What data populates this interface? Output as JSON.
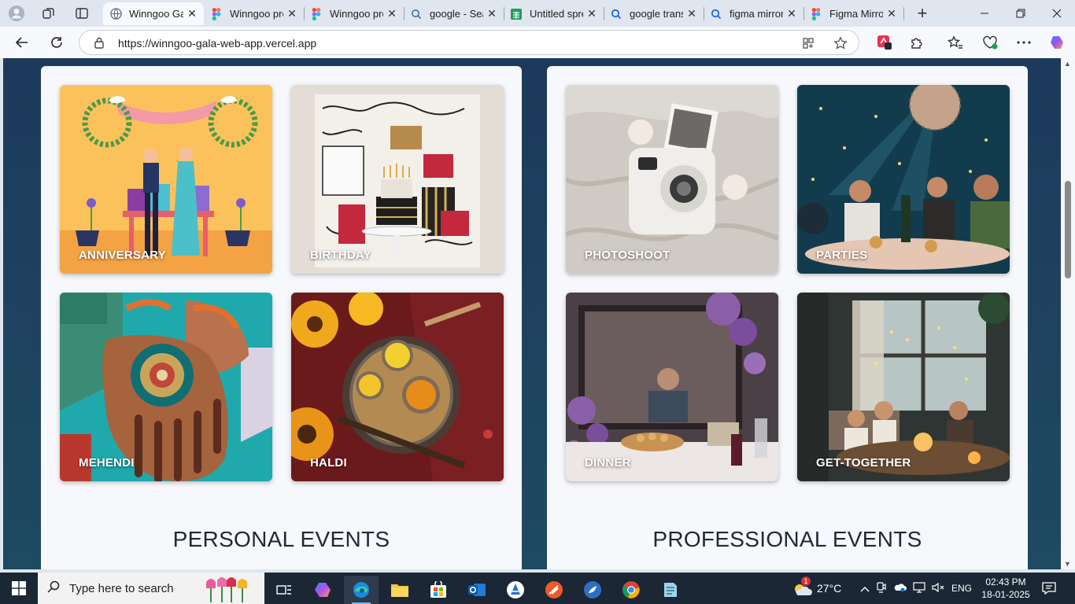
{
  "browser": {
    "tabs": [
      {
        "title": "Winngoo Ga",
        "icon": "globe-icon",
        "active": true
      },
      {
        "title": "Winngoo pro",
        "icon": "figma-icon",
        "active": false
      },
      {
        "title": "Winngoo pro",
        "icon": "figma-icon",
        "active": false
      },
      {
        "title": "google - Sea",
        "icon": "search-icon",
        "active": false
      },
      {
        "title": "Untitled spre",
        "icon": "sheets-icon",
        "active": false
      },
      {
        "title": "google trans",
        "icon": "search-icon",
        "active": false
      },
      {
        "title": "figma mirror",
        "icon": "search-icon",
        "active": false
      },
      {
        "title": "Figma Mirro",
        "icon": "figma-icon",
        "active": false
      }
    ],
    "url": "https://winngoo-gala-web-app.vercel.app"
  },
  "page": {
    "personal": {
      "heading": "PERSONAL EVENTS",
      "cards": [
        "ANNIVERSARY",
        "BIRTHDAY",
        "MEHENDI",
        "HALDI"
      ]
    },
    "professional": {
      "heading": "PROFESSIONAL EVENTS",
      "cards": [
        "PHOTOSHOOT",
        "PARTIES",
        "DINNER",
        "GET-TOGETHER"
      ]
    }
  },
  "taskbar": {
    "search_placeholder": "Type here to search",
    "weather": "27°C",
    "weather_badge": "1",
    "language": "ENG",
    "time": "02:43 PM",
    "date": "18-01-2025"
  },
  "colors": {
    "page_bg": "#1d3a5c",
    "panel_bg": "#f6f8fb",
    "taskbar_bg": "#1b2735",
    "accent": "#0078d4"
  }
}
